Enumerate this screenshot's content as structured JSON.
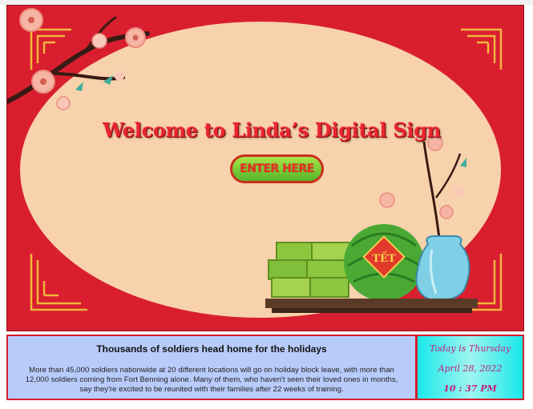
{
  "sign": {
    "welcome_title": "Welcome to Linda’s Digital Sign",
    "enter_button_label": "ENTER HERE",
    "badge_text": "TẾT"
  },
  "news": {
    "headline": "Thousands of soldiers head home for the holidays",
    "body": "More than 45,000 soldiers nationwide at 20 different locations will go on holiday block leave, with more than 12,000 soldiers coming from Fort Benning alone. Many of them, who haven't seen their loved ones in months, say they're excited to be reunited with their families after 22 weeks of training."
  },
  "clock": {
    "day_line": "Today is Thursday",
    "date_line": "April 28, 2022",
    "time_line": "10 : 37 PM"
  },
  "colors": {
    "background_red": "#d91f2f",
    "oval_peach": "#f8d2ac",
    "news_panel": "#b8ccfb",
    "clock_panel": "#19e8ea",
    "button_green": "#7cd13a"
  },
  "icons": [
    "plum-blossom-branch-icon",
    "corner-ornament-icon",
    "watermelon-icon",
    "banh-chung-stack-icon",
    "blue-vase-icon"
  ]
}
